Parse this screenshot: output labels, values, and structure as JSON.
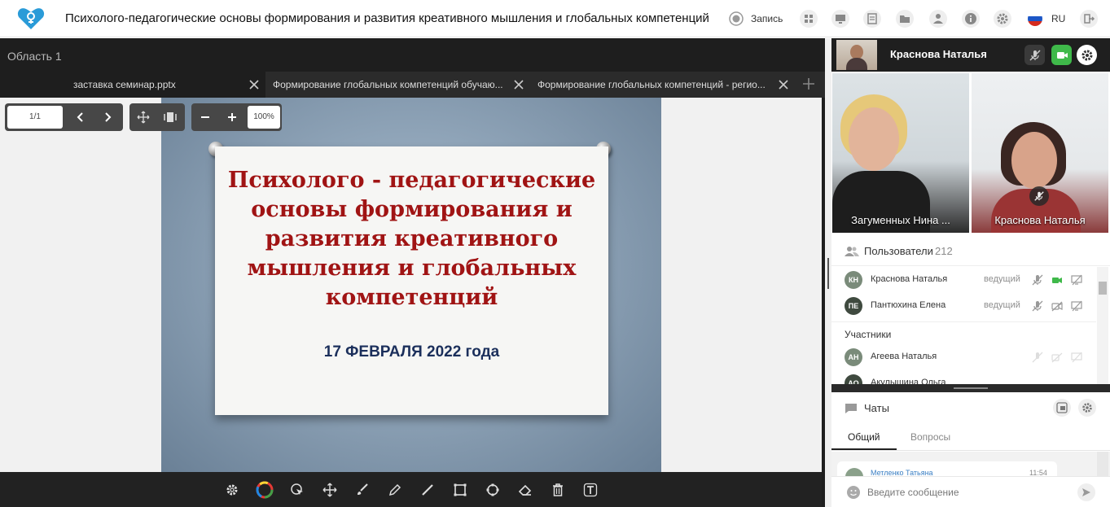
{
  "app": {
    "title": "Психолого-педагогические основы формирования и развития креативного мышления и глобальных компетенций",
    "record_label": "Запись",
    "language": "RU",
    "accent": "#2a9bd8"
  },
  "area": {
    "title": "Область 1"
  },
  "tabs": [
    {
      "label": "заставка семинар.pptx",
      "active": true
    },
    {
      "label": "Формирование глобальных компетенций обучаю...",
      "active": false
    },
    {
      "label": "Формирование глобальных компетенций - регио...",
      "active": false
    }
  ],
  "presentation": {
    "page": "1/1",
    "zoom": "100%",
    "slide_title": "Психолого - педагогические\nосновы формирования и\nразвития креативного\nмышления и глобальных\nкомпетенций",
    "slide_date": "17 ФЕВРАЛЯ 2022 года"
  },
  "self_user": {
    "name": "Краснова Наталья"
  },
  "videos": [
    {
      "name": "Загуменных Нина ..."
    },
    {
      "name": "Краснова Наталья"
    }
  ],
  "users": {
    "label": "Пользователи",
    "count": "212",
    "presenters": [
      {
        "initials": "КН",
        "name": "Краснова Наталья",
        "role": "ведущий",
        "color": "#7a8b7a"
      },
      {
        "initials": "ПЕ",
        "name": "Пантюхина Елена",
        "role": "ведущий",
        "color": "#3f4a3f"
      }
    ],
    "participants_label": "Участники",
    "participants": [
      {
        "initials": "АН",
        "name": "Агеева Наталья",
        "color": "#7a8b7a"
      },
      {
        "initials": "АО",
        "name": "Акулышина Ольга",
        "color": "#3f4a3f"
      }
    ]
  },
  "chat": {
    "label": "Чаты",
    "tabs": [
      "Общий",
      "Вопросы"
    ],
    "last_message": {
      "name": "Метленко Татьяна",
      "time": "11:54"
    },
    "input_placeholder": "Введите сообщение"
  }
}
